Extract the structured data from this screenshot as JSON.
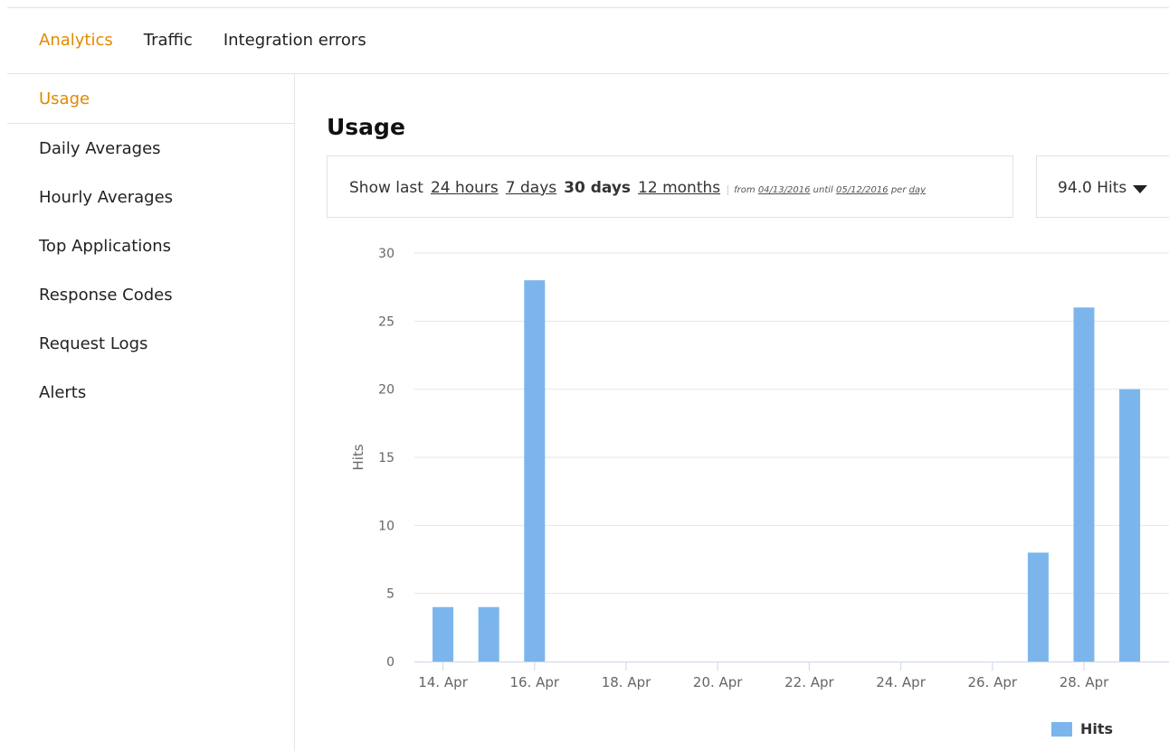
{
  "topnav": {
    "tabs": [
      "Analytics",
      "Traffic",
      "Integration errors"
    ],
    "active": "Analytics"
  },
  "sidebar": {
    "items": [
      "Usage",
      "Daily Averages",
      "Hourly Averages",
      "Top Applications",
      "Response Codes",
      "Request Logs",
      "Alerts"
    ],
    "active": "Usage"
  },
  "main": {
    "title": "Usage",
    "filter": {
      "prefix": "Show last",
      "options": [
        "24 hours",
        "7 days",
        "30 days",
        "12 months"
      ],
      "selected": "30 days",
      "range": {
        "from_label": "from",
        "from": "04/13/2016",
        "until_label": "until",
        "until": "05/12/2016",
        "per_label": "per",
        "per": "day"
      }
    },
    "hits_select": {
      "value": "94.0 Hits",
      "icon": "caret-down-icon"
    }
  },
  "colors": {
    "accent": "#e08a00",
    "bar": "#7cb5ec",
    "grid": "#e6e6e6"
  },
  "chart_data": {
    "type": "bar",
    "x_start": "2016-04-13",
    "categories": [
      "13. Apr",
      "14. Apr",
      "15. Apr",
      "16. Apr",
      "17. Apr",
      "18. Apr",
      "19. Apr",
      "20. Apr",
      "21. Apr",
      "22. Apr",
      "23. Apr",
      "24. Apr",
      "25. Apr",
      "26. Apr",
      "27. Apr",
      "28. Apr",
      "29. Apr"
    ],
    "x_tick_labels": [
      "14. Apr",
      "16. Apr",
      "18. Apr",
      "20. Apr",
      "22. Apr",
      "24. Apr",
      "26. Apr",
      "28. Apr"
    ],
    "series": [
      {
        "name": "Hits",
        "values": [
          0,
          4,
          4,
          28,
          0,
          0,
          0,
          0,
          0,
          0,
          0,
          0,
          0,
          0,
          8,
          26,
          20
        ]
      }
    ],
    "ylabel": "Hits",
    "xlabel": "",
    "ylim": [
      0,
      30
    ],
    "y_ticks": [
      0,
      5,
      10,
      15,
      20,
      25,
      30
    ],
    "grid": true,
    "legend": "bottom-right"
  }
}
